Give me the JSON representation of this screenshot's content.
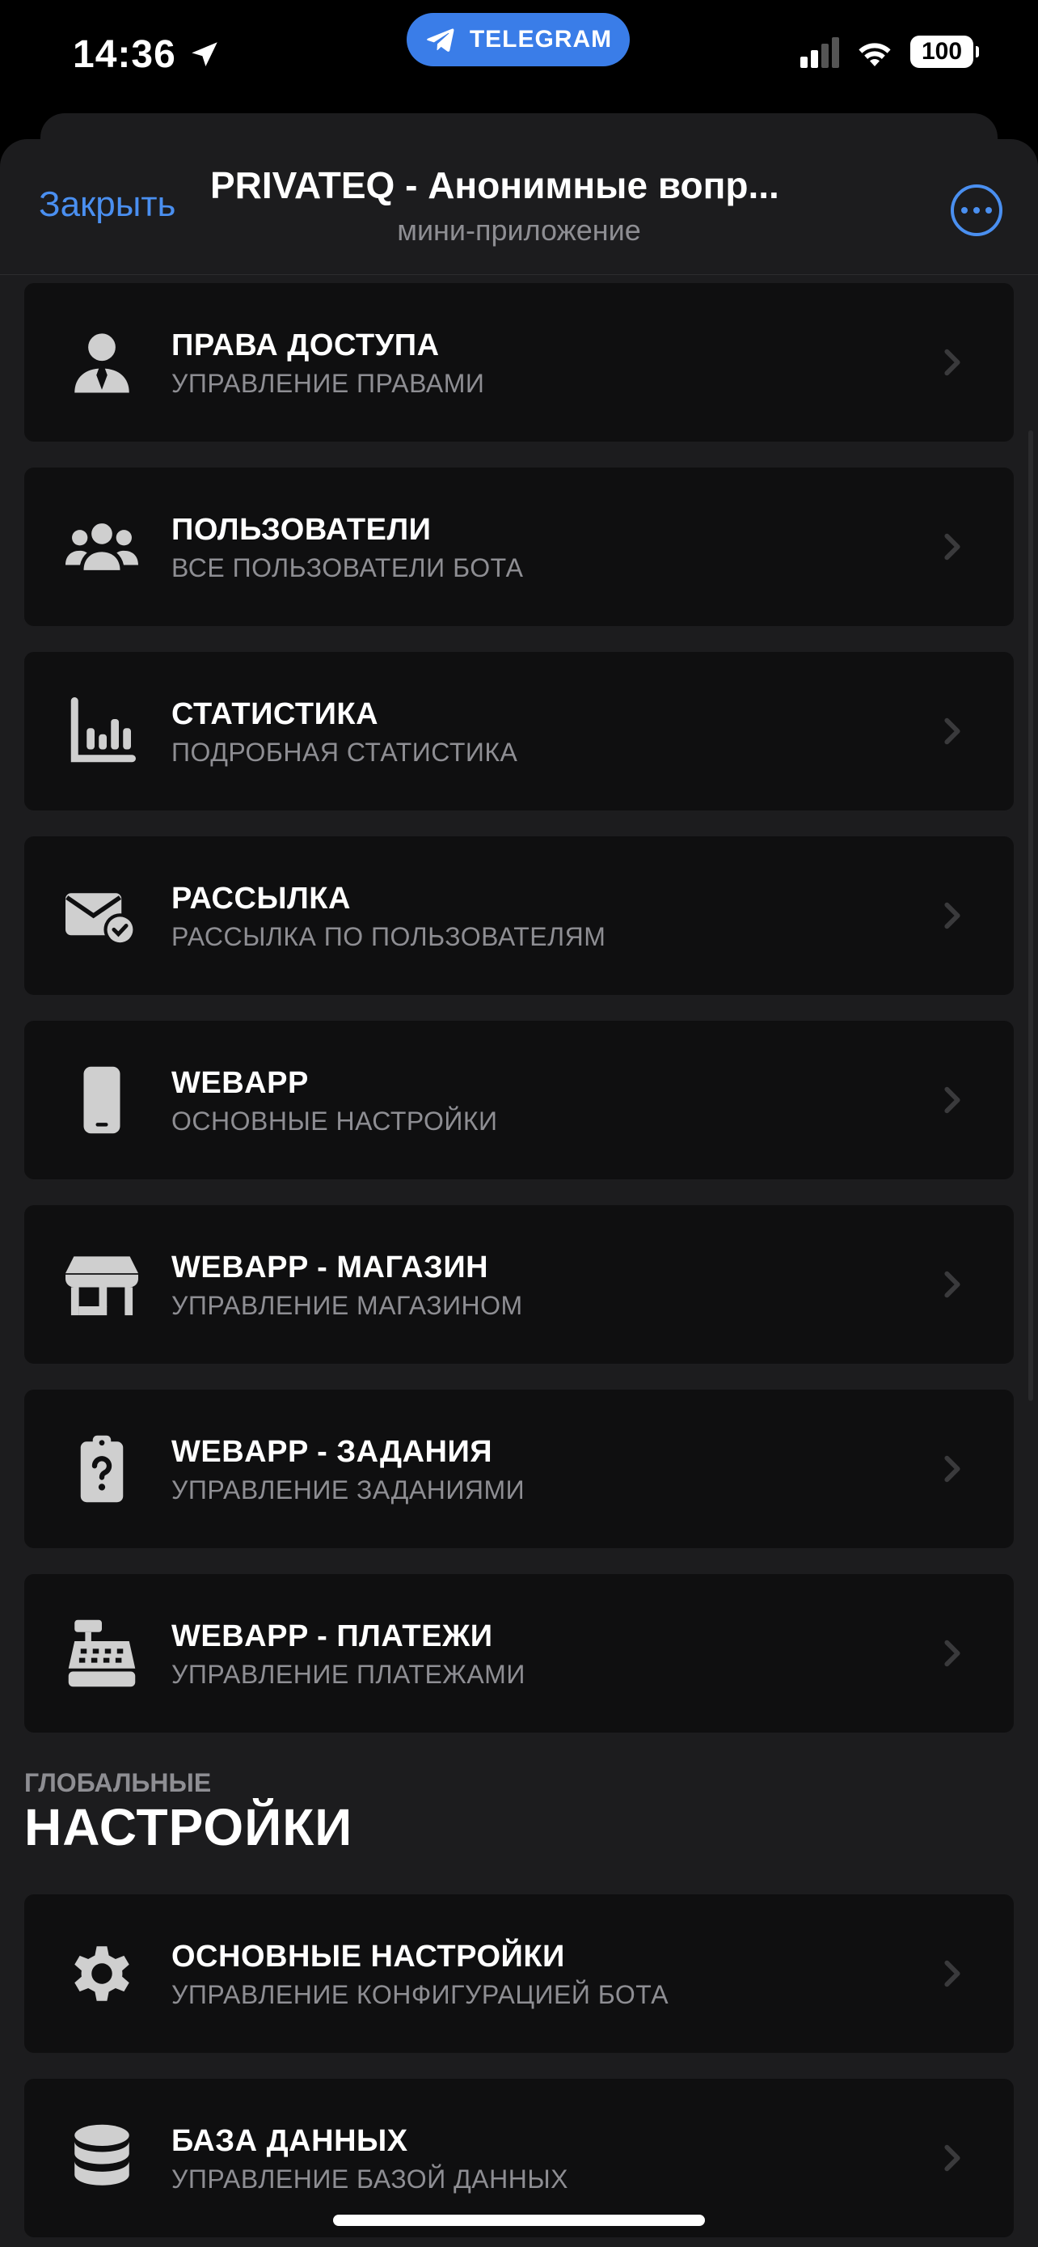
{
  "status_bar": {
    "time": "14:36",
    "battery": "100",
    "app_pill": "TELEGRAM"
  },
  "header": {
    "close_label": "Закрыть",
    "title": "PRIVATEQ - Анонимные вопр...",
    "subtitle": "мини-приложение"
  },
  "menu": [
    {
      "title": "ПРАВА ДОСТУПА",
      "subtitle": "УПРАВЛЕНИЕ ПРАВАМИ",
      "icon": "user-tie-icon"
    },
    {
      "title": "ПОЛЬЗОВАТЕЛИ",
      "subtitle": "ВСЕ ПОЛЬЗОВАТЕЛИ БОТА",
      "icon": "users-icon"
    },
    {
      "title": "СТАТИСТИКА",
      "subtitle": "ПОДРОБНАЯ СТАТИСТИКА",
      "icon": "chart-icon"
    },
    {
      "title": "РАССЫЛКА",
      "subtitle": "РАССЫЛКА ПО ПОЛЬЗОВАТЕЛЯМ",
      "icon": "envelope-check-icon"
    },
    {
      "title": "WEBAPP",
      "subtitle": "ОСНОВНЫЕ НАСТРОЙКИ",
      "icon": "phone-icon"
    },
    {
      "title": "WEBAPP - МАГАЗИН",
      "subtitle": "УПРАВЛЕНИЕ МАГАЗИНОМ",
      "icon": "shop-icon"
    },
    {
      "title": "WEBAPP - ЗАДАНИЯ",
      "subtitle": "УПРАВЛЕНИЕ ЗАДАНИЯМИ",
      "icon": "clipboard-question-icon"
    },
    {
      "title": "WEBAPP - ПЛАТЕЖИ",
      "subtitle": "УПРАВЛЕНИЕ ПЛАТЕЖАМИ",
      "icon": "cash-register-icon"
    }
  ],
  "global_section": {
    "kicker": "ГЛОБАЛЬНЫЕ",
    "title": "НАСТРОЙКИ"
  },
  "global_menu": [
    {
      "title": "ОСНОВНЫЕ НАСТРОЙКИ",
      "subtitle": "УПРАВЛЕНИЕ КОНФИГУРАЦИЕЙ БОТА",
      "icon": "gear-icon"
    },
    {
      "title": "БАЗА ДАННЫХ",
      "subtitle": "УПРАВЛЕНИЕ БАЗОЙ ДАННЫХ",
      "icon": "database-icon"
    }
  ],
  "colors": {
    "accent": "#4a8ff0",
    "telegram": "#3a7de8",
    "card": "#0f0f10",
    "sheet": "#1c1c1e"
  }
}
